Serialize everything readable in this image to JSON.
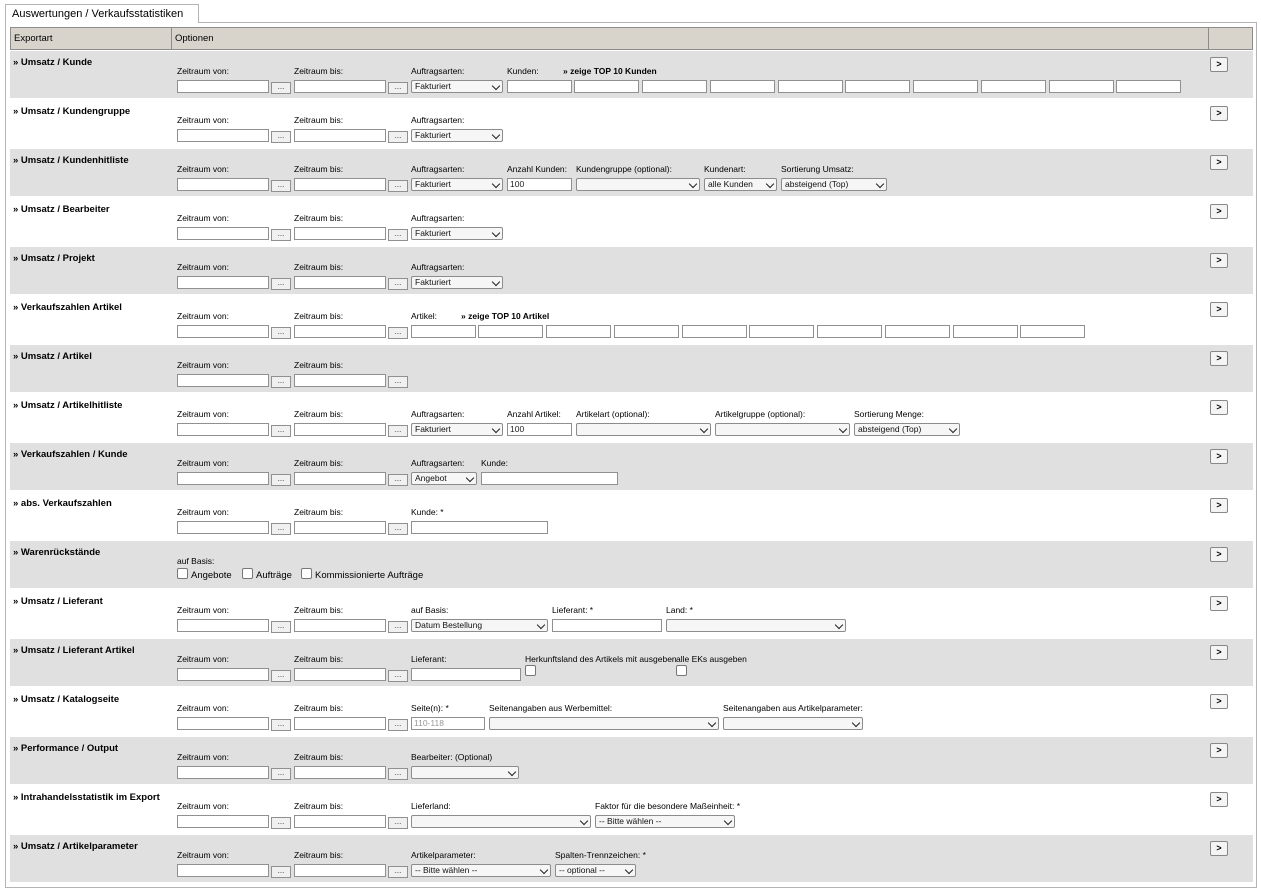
{
  "tab": {
    "label": "Auswertungen / Verkaufsstatistiken"
  },
  "header": {
    "col_exportart": "Exportart",
    "col_optionen": "Optionen"
  },
  "common": {
    "zeitraum_von": "Zeitraum von:",
    "zeitraum_bis": "Zeitraum bis:",
    "auftragsarten": "Auftragsarten:",
    "picker": "...",
    "run": ">",
    "fakturiert": "Fakturiert"
  },
  "rows": {
    "kunde": {
      "title": "» Umsatz / Kunde",
      "kunden_label": "Kunden:",
      "top10": "» zeige TOP 10 Kunden"
    },
    "kundengruppe": {
      "title": "» Umsatz / Kundengruppe"
    },
    "kundenhitliste": {
      "title": "» Umsatz / Kundenhitliste",
      "anzahl_label": "Anzahl Kunden:",
      "anzahl_value": "100",
      "kundengruppe_label": "Kundengruppe (optional):",
      "kundenart_label": "Kundenart:",
      "kundenart_value": "alle Kunden",
      "sortierung_label": "Sortierung Umsatz:",
      "sortierung_value": "absteigend (Top)"
    },
    "bearbeiter": {
      "title": "» Umsatz / Bearbeiter"
    },
    "projekt": {
      "title": "» Umsatz / Projekt"
    },
    "verkaufszahlen_artikel": {
      "title": "» Verkaufszahlen Artikel",
      "artikel_label": "Artikel:",
      "top10": "» zeige TOP 10 Artikel"
    },
    "artikel": {
      "title": "» Umsatz / Artikel"
    },
    "artikelhitliste": {
      "title": "» Umsatz / Artikelhitliste",
      "anzahl_label": "Anzahl Artikel:",
      "anzahl_value": "100",
      "artikelart_label": "Artikelart (optional):",
      "artikelgruppe_label": "Artikelgruppe (optional):",
      "sortierung_label": "Sortierung Menge:",
      "sortierung_value": "absteigend (Top)"
    },
    "verkaufszahlen_kunde": {
      "title": "» Verkaufszahlen / Kunde",
      "auftragsart_value": "Angebot",
      "kunde_label": "Kunde:"
    },
    "abs_verkaufszahlen": {
      "title": "» abs. Verkaufszahlen",
      "kunde_label": "Kunde: *"
    },
    "warenrueckstaende": {
      "title": "» Warenrückstände",
      "basis_label": "auf Basis:",
      "cb_angebote": "Angebote",
      "cb_auftraege": "Aufträge",
      "cb_kommissioniert": "Kommissionierte Aufträge"
    },
    "lieferant": {
      "title": "» Umsatz / Lieferant",
      "basis_label": "auf Basis:",
      "basis_value": "Datum Bestellung",
      "lieferant_label": "Lieferant: *",
      "land_label": "Land: *"
    },
    "lieferant_artikel": {
      "title": "» Umsatz / Lieferant Artikel",
      "lieferant_label": "Lieferant:",
      "herkunft_label": "Herkunftsland des Artikels mit ausgeben",
      "alle_eks_label": "alle EKs ausgeben"
    },
    "katalogseite": {
      "title": "» Umsatz / Katalogseite",
      "seiten_label": "Seite(n): *",
      "seiten_placeholder": "110-118",
      "werbemittel_label": "Seitenangaben aus Werbemittel:",
      "artikelparameter_label": "Seitenangaben aus Artikelparameter:"
    },
    "performance": {
      "title": "» Performance / Output",
      "bearbeiter_label": "Bearbeiter: (Optional)"
    },
    "intrahandel": {
      "title": "» Intrahandelsstatistik im Export",
      "lieferland_label": "Lieferland:",
      "faktor_label": "Faktor für die besondere Maßeinheit: *",
      "faktor_value": "-- Bitte wählen --"
    },
    "artikelparameter": {
      "title": "» Umsatz / Artikelparameter",
      "param_label": "Artikelparameter:",
      "param_value": "-- Bitte wählen --",
      "trenn_label": "Spalten-Trennzeichen: *",
      "trenn_value": "-- optional --"
    }
  }
}
